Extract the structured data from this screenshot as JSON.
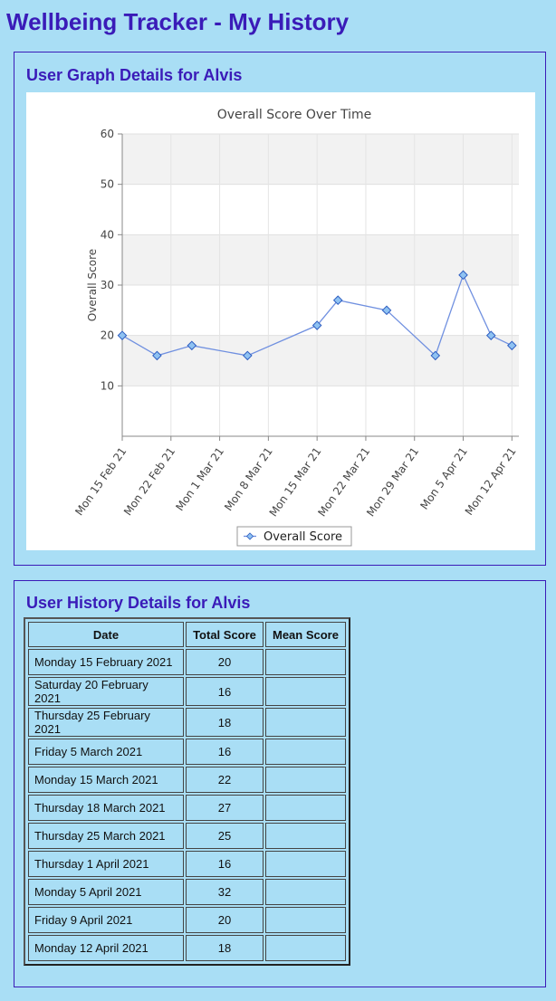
{
  "page": {
    "title": "Wellbeing Tracker - My History"
  },
  "graph_section": {
    "heading": "User Graph Details for Alvis"
  },
  "history_section": {
    "heading": "User History Details for Alvis",
    "columns": [
      "Date",
      "Total Score",
      "Mean Score"
    ],
    "rows": [
      {
        "date": "Monday 15 February 2021",
        "total": "20",
        "mean": ""
      },
      {
        "date": "Saturday 20 February 2021",
        "total": "16",
        "mean": ""
      },
      {
        "date": "Thursday 25 February 2021",
        "total": "18",
        "mean": ""
      },
      {
        "date": "Friday 5 March 2021",
        "total": "16",
        "mean": ""
      },
      {
        "date": "Monday 15 March 2021",
        "total": "22",
        "mean": ""
      },
      {
        "date": "Thursday 18 March 2021",
        "total": "27",
        "mean": ""
      },
      {
        "date": "Thursday 25 March 2021",
        "total": "25",
        "mean": ""
      },
      {
        "date": "Thursday 1 April 2021",
        "total": "16",
        "mean": ""
      },
      {
        "date": "Monday 5 April 2021",
        "total": "32",
        "mean": ""
      },
      {
        "date": "Friday 9 April 2021",
        "total": "20",
        "mean": ""
      },
      {
        "date": "Monday 12 April 2021",
        "total": "18",
        "mean": ""
      }
    ]
  },
  "chart_data": {
    "type": "line",
    "title": "Overall Score Over Time",
    "ylabel": "Overall Score",
    "xlabel": "",
    "ylim": [
      0,
      60
    ],
    "yticks": [
      10,
      20,
      30,
      40,
      50,
      60
    ],
    "xlim": [
      "2021-02-15",
      "2021-04-13"
    ],
    "xticks": [
      {
        "date": "2021-02-15",
        "label": "Mon 15 Feb 21"
      },
      {
        "date": "2021-02-22",
        "label": "Mon 22 Feb 21"
      },
      {
        "date": "2021-03-01",
        "label": "Mon 1 Mar 21"
      },
      {
        "date": "2021-03-08",
        "label": "Mon 8 Mar 21"
      },
      {
        "date": "2021-03-15",
        "label": "Mon 15 Mar 21"
      },
      {
        "date": "2021-03-22",
        "label": "Mon 22 Mar 21"
      },
      {
        "date": "2021-03-29",
        "label": "Mon 29 Mar 21"
      },
      {
        "date": "2021-04-05",
        "label": "Mon 5 Apr 21"
      },
      {
        "date": "2021-04-12",
        "label": "Mon 12 Apr 21"
      }
    ],
    "series": [
      {
        "name": "Overall Score",
        "x": [
          "2021-02-15",
          "2021-02-20",
          "2021-02-25",
          "2021-03-05",
          "2021-03-15",
          "2021-03-18",
          "2021-03-25",
          "2021-04-01",
          "2021-04-05",
          "2021-04-09",
          "2021-04-12"
        ],
        "y": [
          20,
          16,
          18,
          16,
          22,
          27,
          25,
          16,
          32,
          20,
          18
        ],
        "color": "#7090e0",
        "marker_color": "#8fc2f2"
      }
    ],
    "legend": {
      "position": "bottom",
      "label": "Overall Score"
    },
    "grid": true,
    "band_color": "#f2f2f2"
  }
}
